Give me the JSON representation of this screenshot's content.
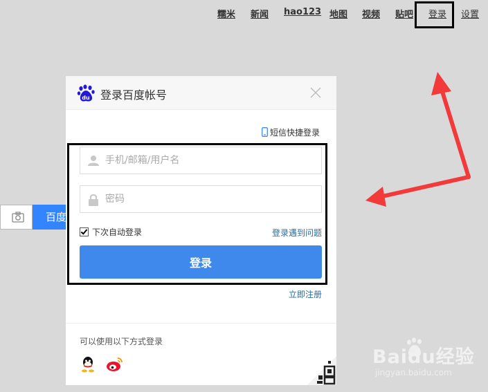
{
  "topnav": {
    "items": [
      {
        "label": "糯米",
        "bold": true
      },
      {
        "label": "新闻",
        "bold": true
      },
      {
        "label": "hao123",
        "bold": true
      },
      {
        "label": "地图",
        "bold": true
      },
      {
        "label": "视频",
        "bold": true
      },
      {
        "label": "贴吧",
        "bold": true
      },
      {
        "label": "登录",
        "bold": false
      },
      {
        "label": "设置",
        "bold": false
      }
    ]
  },
  "search": {
    "button_label": "百度一下"
  },
  "dialog": {
    "title": "登录百度帐号",
    "sms_login": "短信快捷登录",
    "username": {
      "placeholder": "手机/邮箱/用户名",
      "value": ""
    },
    "password": {
      "placeholder": "密码",
      "value": ""
    },
    "remember_me": {
      "label": "下次自动登录",
      "checked": true
    },
    "problem_link": "登录遇到问题",
    "login_button": "登录",
    "register_link": "立即注册",
    "other_methods": "可以使用以下方式登录"
  },
  "watermark": {
    "brand": "Baidu经验",
    "url": "jingyan.baidu.com"
  },
  "colors": {
    "background": "#d9d9d9",
    "login_button": "#3f89ec",
    "search_button": "#3385ff",
    "link": "#2c6b9e",
    "arrow": "#f23a3a",
    "highlight_box": "#000000"
  }
}
